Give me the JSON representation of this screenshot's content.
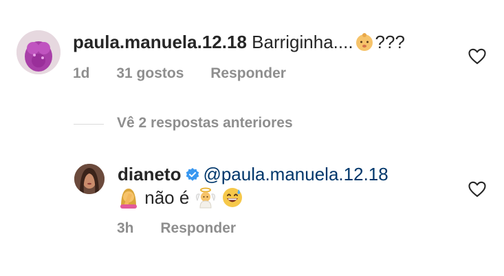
{
  "comment": {
    "username": "paula.manuela.12.18",
    "text_before": "Barriginha....",
    "text_after": "???",
    "time": "1d",
    "likes": "31 gostos",
    "reply_label": "Responder",
    "emoji": "baby-emoji"
  },
  "view_replies": "Vê 2 respostas anteriores",
  "reply": {
    "username": "dianeto",
    "verified": true,
    "mention": "@paula.manuela.12.18",
    "text": "não é",
    "time": "3h",
    "reply_label": "Responder",
    "emojis": [
      "woman-facepalming-emoji",
      "baby-angel-emoji",
      "grinning-sweat-emoji"
    ]
  },
  "colors": {
    "text": "#262626",
    "meta": "#8e8e8e",
    "mention": "#00376b",
    "verified": "#3897f0"
  }
}
